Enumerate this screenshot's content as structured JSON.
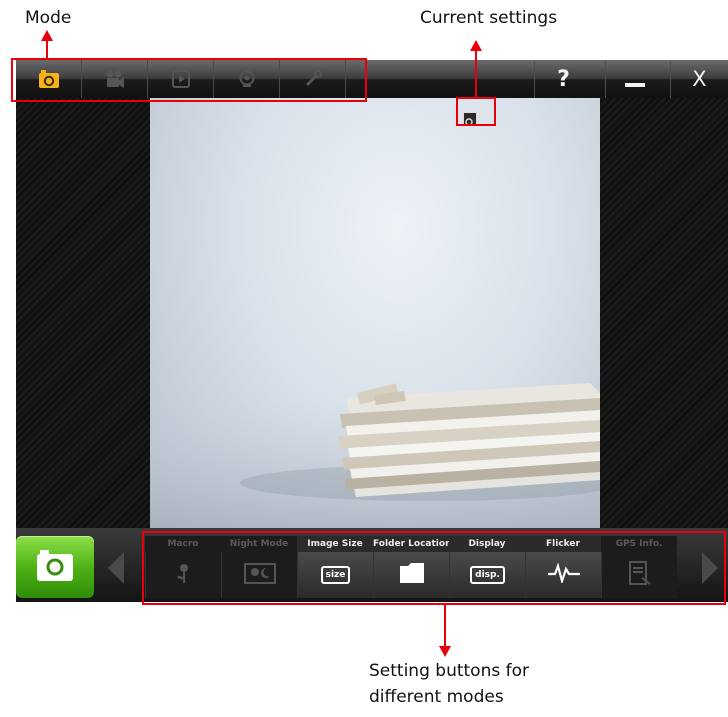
{
  "annotations": {
    "mode": "Mode",
    "current_settings": "Current settings",
    "setting_buttons_line1": "Setting buttons for",
    "setting_buttons_line2": "different modes"
  },
  "titlebar": {
    "modes": [
      {
        "icon": "camera-icon",
        "active": true
      },
      {
        "icon": "video-camera-icon",
        "active": false
      },
      {
        "icon": "playback-icon",
        "active": false
      },
      {
        "icon": "webcam-icon",
        "active": false
      },
      {
        "icon": "tools-icon",
        "active": false
      }
    ],
    "help_label": "?",
    "minimize_icon": "minimize-icon",
    "close_label": "X"
  },
  "current_settings_icon": "settings-indicator-icon",
  "bottom": {
    "mode_button_icon": "camera-icon",
    "settings": [
      {
        "label": "Macro",
        "icon": "flower-icon",
        "enabled": false
      },
      {
        "label": "Night Mode",
        "icon": "night-portrait-icon",
        "enabled": false
      },
      {
        "label": "Image Size",
        "icon": "size-icon",
        "icon_text": "size",
        "enabled": true
      },
      {
        "label": "Folder Location",
        "icon": "folder-icon",
        "enabled": true
      },
      {
        "label": "Display",
        "icon": "display-icon",
        "icon_text": "disp.",
        "enabled": true
      },
      {
        "label": "Flicker",
        "icon": "flicker-wave-icon",
        "enabled": true
      },
      {
        "label": "GPS Info.",
        "icon": "gps-info-icon",
        "enabled": false
      }
    ]
  },
  "colors": {
    "annotation": "#e8000b",
    "mode_active": "#f5b219",
    "mode_button_green": "#4db316"
  }
}
